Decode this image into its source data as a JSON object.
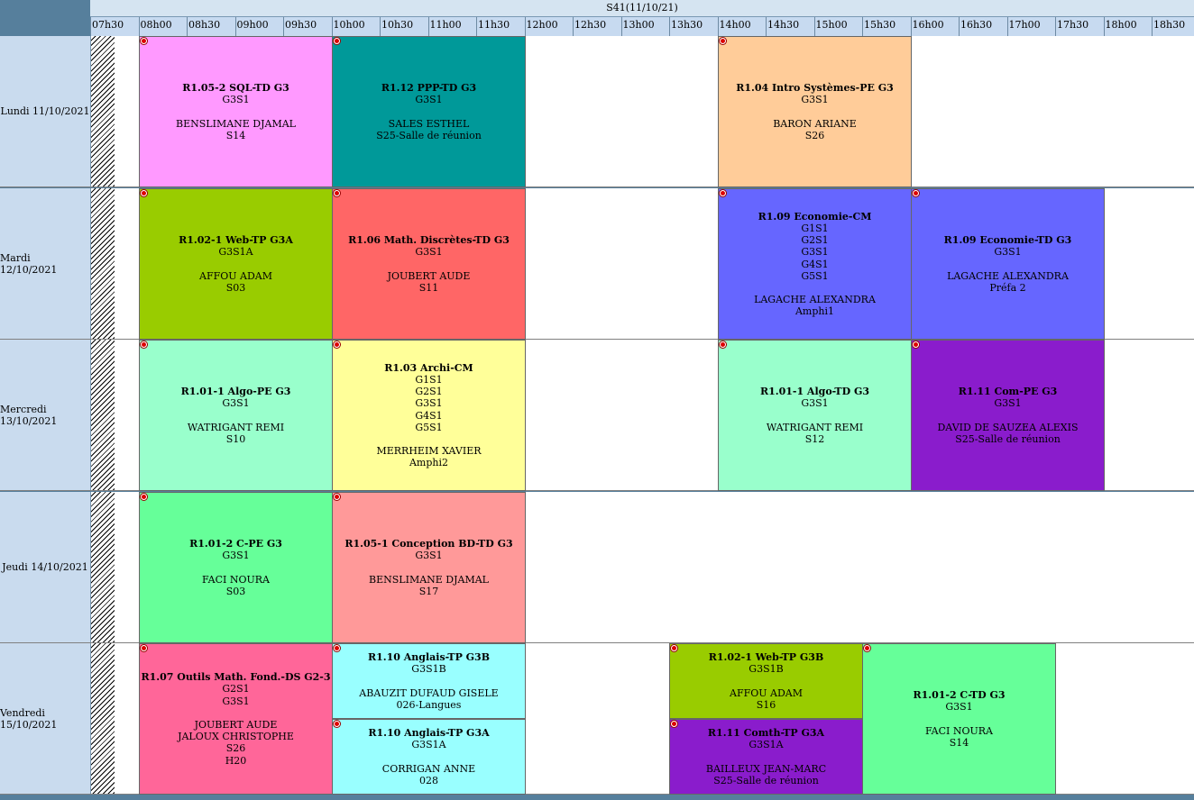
{
  "week_label": "S41(11/10/21)",
  "hours": [
    "07h30",
    "08h00",
    "08h30",
    "09h00",
    "09h30",
    "10h00",
    "10h30",
    "11h00",
    "11h30",
    "12h00",
    "12h30",
    "13h00",
    "13h30",
    "14h00",
    "14h30",
    "15h00",
    "15h30",
    "16h00",
    "16h30",
    "17h00",
    "17h30",
    "18h00",
    "18h30"
  ],
  "days": [
    "Lundi 11/10/2021",
    "Mardi 12/10/2021",
    "Mercredi 13/10/2021",
    "Jeudi 14/10/2021",
    "Vendredi 15/10/2021"
  ],
  "events": [
    {
      "day": 0,
      "start": "08h00",
      "end": "10h00",
      "half": "full",
      "color": "#ff99ff",
      "title": "R1.05-2 SQL-TD G3",
      "groups": [
        "G3S1"
      ],
      "teachers": [
        "BENSLIMANE DJAMAL"
      ],
      "rooms": [
        "S14"
      ]
    },
    {
      "day": 0,
      "start": "10h00",
      "end": "12h00",
      "half": "full",
      "color": "#009999",
      "title": "R1.12 PPP-TD G3",
      "groups": [
        "G3S1"
      ],
      "teachers": [
        "SALES ESTHEL"
      ],
      "rooms": [
        "S25-Salle de réunion"
      ]
    },
    {
      "day": 0,
      "start": "14h00",
      "end": "16h00",
      "half": "full",
      "color": "#ffcc99",
      "title": "R1.04 Intro Systèmes-PE G3",
      "groups": [
        "G3S1"
      ],
      "teachers": [
        "BARON ARIANE"
      ],
      "rooms": [
        "S26"
      ]
    },
    {
      "day": 1,
      "start": "08h00",
      "end": "10h00",
      "half": "full",
      "color": "#99cc00",
      "title": "R1.02-1 Web-TP G3A",
      "groups": [
        "G3S1A"
      ],
      "teachers": [
        "AFFOU ADAM"
      ],
      "rooms": [
        "S03"
      ]
    },
    {
      "day": 1,
      "start": "10h00",
      "end": "12h00",
      "half": "full",
      "color": "#ff6666",
      "title": "R1.06 Math. Discrètes-TD G3",
      "groups": [
        "G3S1"
      ],
      "teachers": [
        "JOUBERT AUDE"
      ],
      "rooms": [
        "S11"
      ]
    },
    {
      "day": 1,
      "start": "14h00",
      "end": "16h00",
      "half": "full",
      "color": "#6666ff",
      "title": "R1.09 Economie-CM",
      "groups": [
        "G1S1",
        "G2S1",
        "G3S1",
        "G4S1",
        "G5S1"
      ],
      "teachers": [
        "LAGACHE ALEXANDRA"
      ],
      "rooms": [
        "Amphi1"
      ]
    },
    {
      "day": 1,
      "start": "16h00",
      "end": "18h00",
      "half": "full",
      "color": "#6666ff",
      "title": "R1.09 Economie-TD G3",
      "groups": [
        "G3S1"
      ],
      "teachers": [
        "LAGACHE ALEXANDRA"
      ],
      "rooms": [
        "Préfa 2"
      ]
    },
    {
      "day": 2,
      "start": "08h00",
      "end": "10h00",
      "half": "full",
      "color": "#99ffcc",
      "title": "R1.01-1 Algo-PE G3",
      "groups": [
        "G3S1"
      ],
      "teachers": [
        "WATRIGANT REMI"
      ],
      "rooms": [
        "S10"
      ]
    },
    {
      "day": 2,
      "start": "10h00",
      "end": "12h00",
      "half": "full",
      "color": "#ffff99",
      "title": "R1.03 Archi-CM",
      "groups": [
        "G1S1",
        "G2S1",
        "G3S1",
        "G4S1",
        "G5S1"
      ],
      "teachers": [
        "MERRHEIM XAVIER"
      ],
      "rooms": [
        "Amphi2"
      ]
    },
    {
      "day": 2,
      "start": "14h00",
      "end": "16h00",
      "half": "full",
      "color": "#99ffcc",
      "title": "R1.01-1 Algo-TD G3",
      "groups": [
        "G3S1"
      ],
      "teachers": [
        "WATRIGANT REMI"
      ],
      "rooms": [
        "S12"
      ]
    },
    {
      "day": 2,
      "start": "16h00",
      "end": "18h00",
      "half": "full",
      "color": "#8a1ccc",
      "title": "R1.11 Com-PE G3",
      "groups": [
        "G3S1"
      ],
      "teachers": [
        "DAVID DE SAUZEA ALEXIS"
      ],
      "rooms": [
        "S25-Salle de réunion"
      ]
    },
    {
      "day": 3,
      "start": "08h00",
      "end": "10h00",
      "half": "full",
      "color": "#66ff99",
      "title": "R1.01-2 C-PE G3",
      "groups": [
        "G3S1"
      ],
      "teachers": [
        "FACI NOURA"
      ],
      "rooms": [
        "S03"
      ]
    },
    {
      "day": 3,
      "start": "10h00",
      "end": "12h00",
      "half": "full",
      "color": "#ff9999",
      "title": "R1.05-1 Conception BD-TD G3",
      "groups": [
        "G3S1"
      ],
      "teachers": [
        "BENSLIMANE DJAMAL"
      ],
      "rooms": [
        "S17"
      ]
    },
    {
      "day": 4,
      "start": "08h00",
      "end": "10h00",
      "half": "full",
      "color": "#ff6699",
      "title": "R1.07 Outils Math. Fond.-DS G2-3",
      "groups": [
        "G2S1",
        "G3S1"
      ],
      "teachers": [
        "JOUBERT AUDE",
        "JALOUX CHRISTOPHE"
      ],
      "rooms": [
        "S26",
        "H20"
      ]
    },
    {
      "day": 4,
      "start": "10h00",
      "end": "12h00",
      "half": "top",
      "color": "#99ffff",
      "title": "R1.10 Anglais-TP G3B",
      "groups": [
        "G3S1B"
      ],
      "teachers": [
        "ABAUZIT DUFAUD GISELE"
      ],
      "rooms": [
        "026-Langues"
      ]
    },
    {
      "day": 4,
      "start": "10h00",
      "end": "12h00",
      "half": "bottom",
      "color": "#99ffff",
      "title": "R1.10 Anglais-TP G3A",
      "groups": [
        "G3S1A"
      ],
      "teachers": [
        "CORRIGAN ANNE"
      ],
      "rooms": [
        "028"
      ]
    },
    {
      "day": 4,
      "start": "13h30",
      "end": "15h30",
      "half": "top",
      "color": "#99cc00",
      "title": "R1.02-1 Web-TP G3B",
      "groups": [
        "G3S1B"
      ],
      "teachers": [
        "AFFOU ADAM"
      ],
      "rooms": [
        "S16"
      ]
    },
    {
      "day": 4,
      "start": "13h30",
      "end": "15h30",
      "half": "bottom",
      "color": "#8a1ccc",
      "title": "R1.11 Comth-TP G3A",
      "groups": [
        "G3S1A"
      ],
      "teachers": [
        "BAILLEUX JEAN-MARC"
      ],
      "rooms": [
        "S25-Salle de réunion"
      ]
    },
    {
      "day": 4,
      "start": "15h30",
      "end": "17h30",
      "half": "full",
      "color": "#66ff99",
      "title": "R1.01-2 C-TD G3",
      "groups": [
        "G3S1"
      ],
      "teachers": [
        "FACI NOURA"
      ],
      "rooms": [
        "S14"
      ]
    }
  ]
}
